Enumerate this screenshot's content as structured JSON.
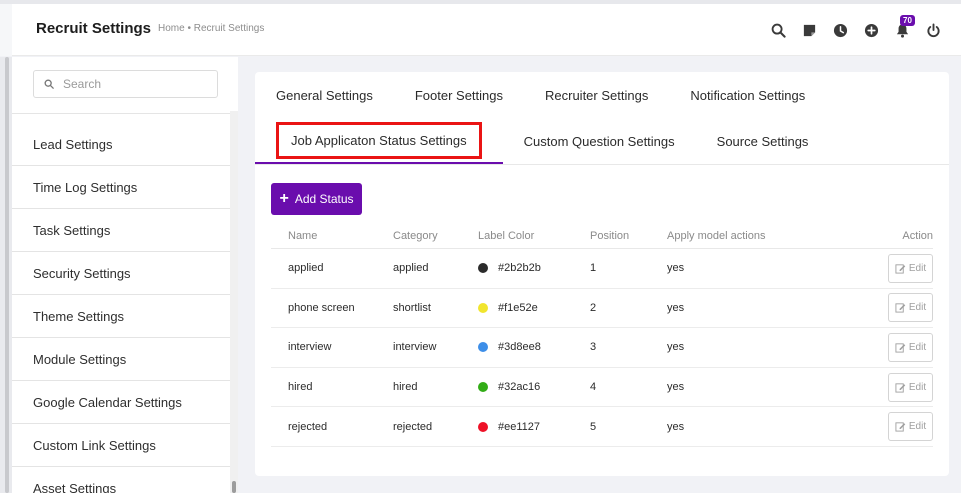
{
  "header": {
    "title": "Recruit Settings",
    "breadcrumb": "Home • Recruit Settings",
    "notification_count": "70",
    "icons": [
      "search-icon",
      "sticky-note-icon",
      "clock-icon",
      "plus-circle-icon",
      "bell-icon",
      "power-icon"
    ]
  },
  "sidebar": {
    "search_placeholder": "Search",
    "items": [
      {
        "label": "Lead Settings"
      },
      {
        "label": "Time Log Settings"
      },
      {
        "label": "Task Settings"
      },
      {
        "label": "Security Settings"
      },
      {
        "label": "Theme Settings"
      },
      {
        "label": "Module Settings"
      },
      {
        "label": "Google Calendar Settings"
      },
      {
        "label": "Custom Link Settings"
      },
      {
        "label": "Asset Settings"
      }
    ]
  },
  "tabs": {
    "row1": [
      {
        "label": "General Settings"
      },
      {
        "label": "Footer Settings"
      },
      {
        "label": "Recruiter Settings"
      },
      {
        "label": "Notification Settings"
      }
    ],
    "row2": [
      {
        "label": "Job Applicaton Status Settings",
        "active": true
      },
      {
        "label": "Custom Question Settings"
      },
      {
        "label": "Source Settings"
      }
    ]
  },
  "add_button_label": "Add Status",
  "table": {
    "columns": [
      "Name",
      "Category",
      "Label Color",
      "Position",
      "Apply model actions",
      "Action"
    ],
    "edit_label": "Edit",
    "rows": [
      {
        "name": "applied",
        "category": "applied",
        "color": "#2b2b2b",
        "position": "1",
        "apply": "yes"
      },
      {
        "name": "phone screen",
        "category": "shortlist",
        "color": "#f1e52e",
        "position": "2",
        "apply": "yes"
      },
      {
        "name": "interview",
        "category": "interview",
        "color": "#3d8ee8",
        "position": "3",
        "apply": "yes"
      },
      {
        "name": "hired",
        "category": "hired",
        "color": "#32ac16",
        "position": "4",
        "apply": "yes"
      },
      {
        "name": "rejected",
        "category": "rejected",
        "color": "#ee1127",
        "position": "5",
        "apply": "yes"
      }
    ]
  },
  "colors": {
    "accent": "#6a0dad",
    "highlight": "#ea1414"
  }
}
